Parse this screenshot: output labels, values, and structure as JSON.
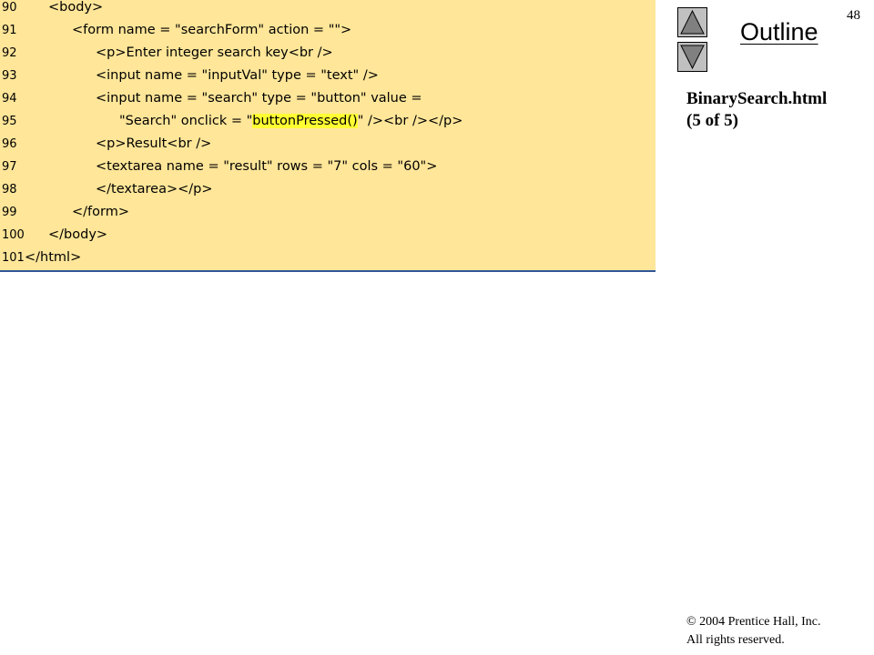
{
  "code": {
    "lines": [
      {
        "no": "90",
        "parts": [
          {
            "text": "<body>",
            "hl": false
          }
        ]
      },
      {
        "no": "91",
        "parts": [
          {
            "text": "<form name = \"searchForm\" action = \"\">",
            "hl": false
          }
        ]
      },
      {
        "no": "92",
        "parts": [
          {
            "text": "<p>Enter integer search key<br />",
            "hl": false
          }
        ]
      },
      {
        "no": "93",
        "parts": [
          {
            "text": "<input name = \"inputVal\" type = \"text\" />",
            "hl": false
          }
        ]
      },
      {
        "no": "94",
        "parts": [
          {
            "text": "<input name = \"search\" type = \"button\" value =",
            "hl": false
          }
        ]
      },
      {
        "no": "95",
        "parts": [
          {
            "text": "\"Search\" onclick = \"",
            "hl": false
          },
          {
            "text": "buttonPressed()",
            "hl": true
          },
          {
            "text": "\" /><br /></p>",
            "hl": false
          }
        ]
      },
      {
        "no": "96",
        "parts": [
          {
            "text": "<p>Result<br />",
            "hl": false
          }
        ]
      },
      {
        "no": "97",
        "parts": [
          {
            "text": "<textarea name = \"result\" rows = \"7\" cols = \"60\">",
            "hl": false
          }
        ]
      },
      {
        "no": "98",
        "parts": [
          {
            "text": "</textarea></p>",
            "hl": false
          }
        ]
      },
      {
        "no": "99",
        "parts": [
          {
            "text": "</form>",
            "hl": false
          }
        ]
      },
      {
        "no": "100",
        "parts": [
          {
            "text": "</body>",
            "hl": false
          }
        ]
      },
      {
        "no": "101",
        "parts": [
          {
            "text": "</html>",
            "hl": false
          }
        ]
      }
    ],
    "indent_levels": [
      1,
      2,
      3,
      3,
      3,
      4,
      3,
      3,
      3,
      2,
      1,
      0
    ]
  },
  "sidebar": {
    "slide_number": "48",
    "outline_title": "Outline",
    "file_label_line1": "BinarySearch.html",
    "file_label_line2": "(5 of 5)",
    "copyright_line1": "© 2004 Prentice Hall, Inc.",
    "copyright_line2": "All rights reserved."
  },
  "nav": {
    "up_icon": "triangle-up-icon",
    "down_icon": "triangle-down-icon"
  },
  "colors": {
    "code_background": "#ffe699",
    "highlight": "#ffff33",
    "nav_button": "#c0c0c0",
    "panel_rule": "#2f5597"
  }
}
